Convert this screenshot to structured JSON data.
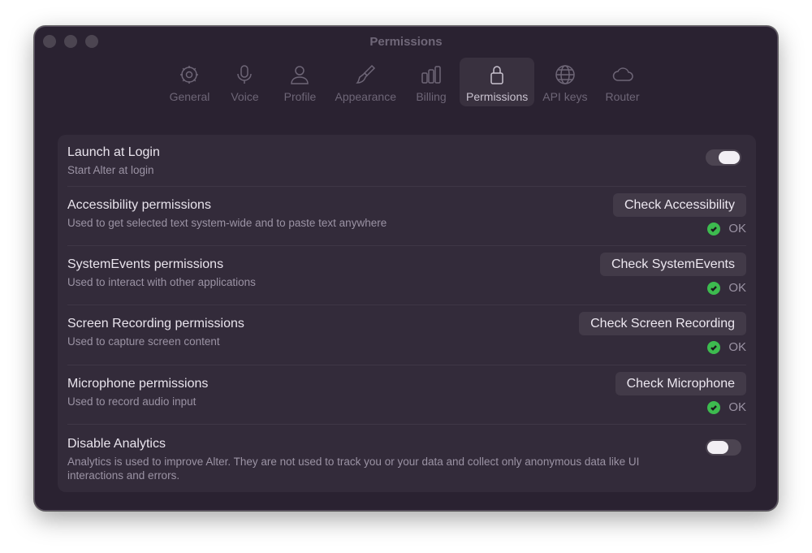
{
  "window": {
    "title": "Permissions"
  },
  "tabs": [
    {
      "label": "General",
      "icon": "gear-icon"
    },
    {
      "label": "Voice",
      "icon": "microphone-icon"
    },
    {
      "label": "Profile",
      "icon": "person-icon"
    },
    {
      "label": "Appearance",
      "icon": "paintbrush-icon"
    },
    {
      "label": "Billing",
      "icon": "bars-icon"
    },
    {
      "label": "Permissions",
      "icon": "lock-icon",
      "active": true
    },
    {
      "label": "API keys",
      "icon": "globe-icon"
    },
    {
      "label": "Router",
      "icon": "cloud-icon"
    }
  ],
  "settings": {
    "launch": {
      "title": "Launch at Login",
      "desc": "Start Alter at login",
      "enabled": true
    },
    "accessibility": {
      "title": "Accessibility permissions",
      "desc": "Used to get selected text system-wide and to paste text anywhere",
      "button": "Check Accessibility",
      "status": "OK"
    },
    "systemevents": {
      "title": "SystemEvents permissions",
      "desc": "Used to interact with other applications",
      "button": "Check SystemEvents",
      "status": "OK"
    },
    "screen": {
      "title": "Screen Recording permissions",
      "desc": "Used to capture screen content",
      "button": "Check Screen Recording",
      "status": "OK"
    },
    "microphone": {
      "title": "Microphone permissions",
      "desc": "Used to record audio input",
      "button": "Check Microphone",
      "status": "OK"
    },
    "analytics": {
      "title": "Disable Analytics",
      "desc": "Analytics is used to improve Alter. They are not used to track you or your data and collect only anonymous data like UI interactions and errors.",
      "enabled": false
    }
  },
  "colors": {
    "status_ok": "#3dbb4f",
    "window_bg": "#2a2231",
    "panel_bg": "#332b3a"
  }
}
